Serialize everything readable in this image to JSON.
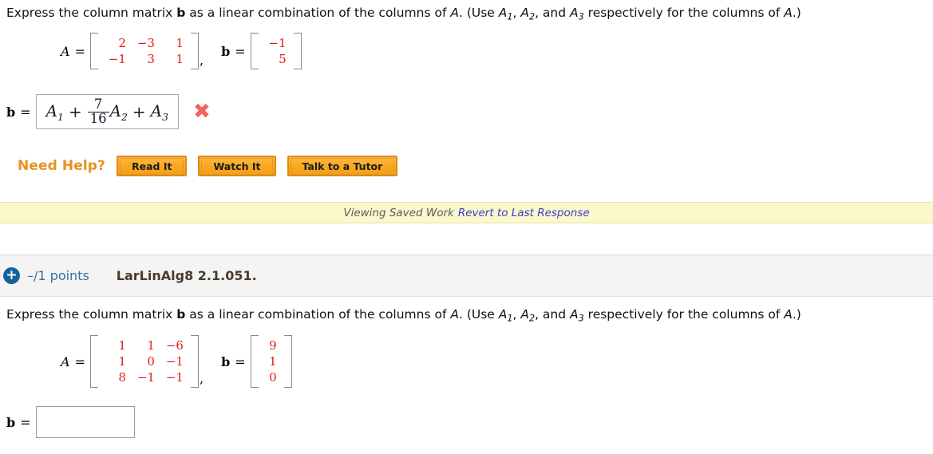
{
  "question1": {
    "prompt_pre": "Express the column matrix ",
    "prompt_b": "b",
    "prompt_mid": " as a linear combination of the columns of ",
    "prompt_a": "A",
    "prompt_paren": ". (Use ",
    "use_a1": "A",
    "use_a1_sub": "1",
    "use_sep1": ", ",
    "use_a2": "A",
    "use_a2_sub": "2",
    "use_sep2": ", and ",
    "use_a3": "A",
    "use_a3_sub": "3",
    "prompt_end": " respectively for the columns of ",
    "prompt_a2": "A",
    "prompt_close": ".)",
    "matrix_a_label": "A",
    "equals": "=",
    "matrix_a": [
      [
        "2",
        "−3",
        "1"
      ],
      [
        "−1",
        "3",
        "1"
      ]
    ],
    "comma": ",",
    "vector_b_label": "b",
    "vector_b": [
      [
        "−1"
      ],
      [
        "5"
      ]
    ],
    "answer": {
      "label": "b",
      "equals": "=",
      "term1_var": "A",
      "term1_sub": "1",
      "op1": "+",
      "frac_num": "7",
      "frac_den": "16",
      "term2_var": "A",
      "term2_sub": "2",
      "op2": "+",
      "term3_var": "A",
      "term3_sub": "3",
      "mark": "✖",
      "mark_meaning": "incorrect"
    },
    "need_help": {
      "label": "Need Help?",
      "buttons": [
        "Read It",
        "Watch It",
        "Talk to a Tutor"
      ]
    }
  },
  "saved_banner": {
    "status": "Viewing Saved Work",
    "revert_link": "Revert to Last Response"
  },
  "points_header": {
    "plus_icon": "+",
    "points": "–/1 points",
    "question_code": "LarLinAlg8 2.1.051."
  },
  "question2": {
    "prompt_pre": "Express the column matrix ",
    "prompt_b": "b",
    "prompt_mid": " as a linear combination of the columns of ",
    "prompt_a": "A",
    "prompt_paren": ". (Use ",
    "use_a1": "A",
    "use_a1_sub": "1",
    "use_sep1": ", ",
    "use_a2": "A",
    "use_a2_sub": "2",
    "use_sep2": ", and ",
    "use_a3": "A",
    "use_a3_sub": "3",
    "prompt_end": " respectively for the columns of ",
    "prompt_a2": "A",
    "prompt_close": ".)",
    "matrix_a_label": "A",
    "equals": "=",
    "matrix_a": [
      [
        "1",
        "1",
        "−6"
      ],
      [
        "1",
        "0",
        "−1"
      ],
      [
        "8",
        "−1",
        "−1"
      ]
    ],
    "comma": ",",
    "vector_b_label": "b",
    "vector_b": [
      [
        "9"
      ],
      [
        "1"
      ],
      [
        "0"
      ]
    ],
    "answer": {
      "label": "b",
      "equals": "=",
      "value": "",
      "placeholder": ""
    }
  },
  "colors": {
    "matrix_entry": "#e01b1b",
    "bracket": "#8a8a8a",
    "help_orange": "#e8921f",
    "button_face": "#f9a91f",
    "banner_yellow": "#fbf8cc",
    "link_blue": "#3b3bcf",
    "points_blue": "#2f73a8",
    "plus_badge": "#14629b",
    "xmark_red": "#f4625f",
    "band_gray": "#f4f4f4"
  }
}
